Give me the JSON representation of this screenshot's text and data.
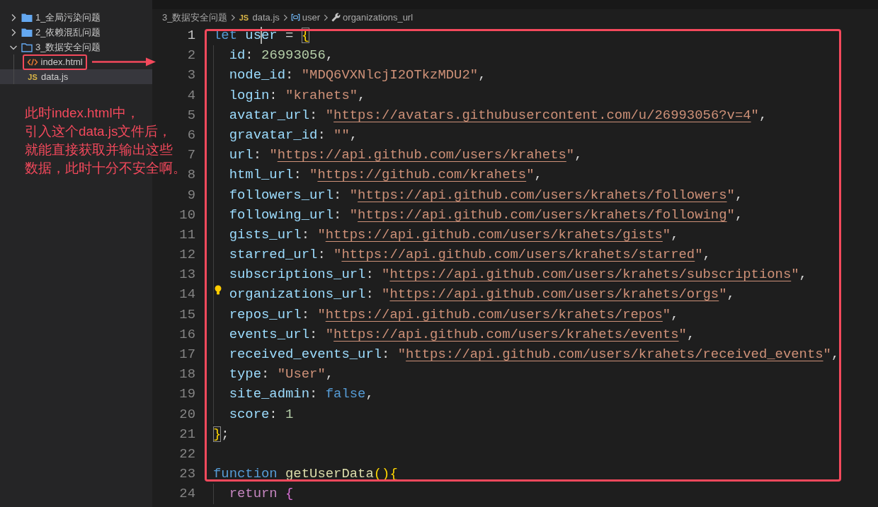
{
  "sidebar": {
    "tree": [
      {
        "kind": "folder",
        "label": "1_全局污染问题",
        "expanded": false,
        "selected": false,
        "highlighted": false
      },
      {
        "kind": "folder",
        "label": "2_依赖混乱问题",
        "expanded": false,
        "selected": false,
        "highlighted": false
      },
      {
        "kind": "folder",
        "label": "3_数据安全问题",
        "expanded": true,
        "selected": false,
        "highlighted": false,
        "children": [
          {
            "kind": "html",
            "label": "index.html",
            "selected": false,
            "highlighted": true
          },
          {
            "kind": "js",
            "icon": "JS",
            "label": "data.js",
            "selected": true,
            "highlighted": false
          }
        ]
      }
    ]
  },
  "editor": {
    "breadcrumb": [
      {
        "kind": "folder",
        "label": "3_数据安全问题"
      },
      {
        "kind": "file",
        "icon": "JS",
        "label": "data.js"
      },
      {
        "kind": "variable",
        "label": "user"
      },
      {
        "kind": "property",
        "label": "organizations_url"
      }
    ],
    "code": {
      "highlighted": true,
      "lines": [
        {
          "number": "1",
          "active": true,
          "lightbulb": false,
          "tokens": [
            {
              "kind": "keyword",
              "text": "let"
            },
            {
              "kind": "variable",
              "text": "us"
            },
            {
              "kind": "cursor"
            },
            {
              "kind": "variable",
              "text": "er"
            },
            {
              "kind": "punct",
              "text": " = "
            },
            {
              "kind": "brace_match",
              "text": "{"
            }
          ],
          "children": [
            {
              "number": "2",
              "active": false,
              "lightbulb": false,
              "tokens": [
                {
                  "kind": "property",
                  "text": "id"
                },
                {
                  "kind": "punct",
                  "text": ": "
                },
                {
                  "kind": "number",
                  "text": "26993056"
                },
                {
                  "kind": "punct",
                  "text": ","
                }
              ]
            },
            {
              "number": "3",
              "active": false,
              "lightbulb": false,
              "tokens": [
                {
                  "kind": "property",
                  "text": "node_id"
                },
                {
                  "kind": "punct",
                  "text": ": "
                },
                {
                  "kind": "string",
                  "text": "\"MDQ6VXNlcjI2OTkzMDU2\""
                },
                {
                  "kind": "punct",
                  "text": ","
                }
              ]
            },
            {
              "number": "4",
              "active": false,
              "lightbulb": false,
              "tokens": [
                {
                  "kind": "property",
                  "text": "login"
                },
                {
                  "kind": "punct",
                  "text": ": "
                },
                {
                  "kind": "string",
                  "text": "\"krahets\""
                },
                {
                  "kind": "punct",
                  "text": ","
                }
              ]
            },
            {
              "number": "5",
              "active": false,
              "lightbulb": false,
              "tokens": [
                {
                  "kind": "property",
                  "text": "avatar_url"
                },
                {
                  "kind": "punct",
                  "text": ": "
                },
                {
                  "kind": "string",
                  "text": "\""
                },
                {
                  "kind": "link",
                  "text": "https://avatars.githubusercontent.com/u/26993056?v=4"
                },
                {
                  "kind": "string",
                  "text": "\""
                },
                {
                  "kind": "punct",
                  "text": ","
                }
              ]
            },
            {
              "number": "6",
              "active": false,
              "lightbulb": false,
              "tokens": [
                {
                  "kind": "property",
                  "text": "gravatar_id"
                },
                {
                  "kind": "punct",
                  "text": ": "
                },
                {
                  "kind": "string",
                  "text": "\"\""
                },
                {
                  "kind": "punct",
                  "text": ","
                }
              ]
            },
            {
              "number": "7",
              "active": false,
              "lightbulb": false,
              "tokens": [
                {
                  "kind": "property",
                  "text": "url"
                },
                {
                  "kind": "punct",
                  "text": ": "
                },
                {
                  "kind": "string",
                  "text": "\""
                },
                {
                  "kind": "link",
                  "text": "https://api.github.com/users/krahets"
                },
                {
                  "kind": "string",
                  "text": "\""
                },
                {
                  "kind": "punct",
                  "text": ","
                }
              ]
            },
            {
              "number": "8",
              "active": false,
              "lightbulb": false,
              "tokens": [
                {
                  "kind": "property",
                  "text": "html_url"
                },
                {
                  "kind": "punct",
                  "text": ": "
                },
                {
                  "kind": "string",
                  "text": "\""
                },
                {
                  "kind": "link",
                  "text": "https://github.com/krahets"
                },
                {
                  "kind": "string",
                  "text": "\""
                },
                {
                  "kind": "punct",
                  "text": ","
                }
              ]
            },
            {
              "number": "9",
              "active": false,
              "lightbulb": false,
              "tokens": [
                {
                  "kind": "property",
                  "text": "followers_url"
                },
                {
                  "kind": "punct",
                  "text": ": "
                },
                {
                  "kind": "string",
                  "text": "\""
                },
                {
                  "kind": "link",
                  "text": "https://api.github.com/users/krahets/followers"
                },
                {
                  "kind": "string",
                  "text": "\""
                },
                {
                  "kind": "punct",
                  "text": ","
                }
              ]
            },
            {
              "number": "10",
              "active": false,
              "lightbulb": false,
              "tokens": [
                {
                  "kind": "property",
                  "text": "following_url"
                },
                {
                  "kind": "punct",
                  "text": ": "
                },
                {
                  "kind": "string",
                  "text": "\""
                },
                {
                  "kind": "link",
                  "text": "https://api.github.com/users/krahets/following"
                },
                {
                  "kind": "string",
                  "text": "\""
                },
                {
                  "kind": "punct",
                  "text": ","
                }
              ]
            },
            {
              "number": "11",
              "active": false,
              "lightbulb": false,
              "tokens": [
                {
                  "kind": "property",
                  "text": "gists_url"
                },
                {
                  "kind": "punct",
                  "text": ": "
                },
                {
                  "kind": "string",
                  "text": "\""
                },
                {
                  "kind": "link",
                  "text": "https://api.github.com/users/krahets/gists"
                },
                {
                  "kind": "string",
                  "text": "\""
                },
                {
                  "kind": "punct",
                  "text": ","
                }
              ]
            },
            {
              "number": "12",
              "active": false,
              "lightbulb": false,
              "tokens": [
                {
                  "kind": "property",
                  "text": "starred_url"
                },
                {
                  "kind": "punct",
                  "text": ": "
                },
                {
                  "kind": "string",
                  "text": "\""
                },
                {
                  "kind": "link",
                  "text": "https://api.github.com/users/krahets/starred"
                },
                {
                  "kind": "string",
                  "text": "\""
                },
                {
                  "kind": "punct",
                  "text": ","
                }
              ]
            },
            {
              "number": "13",
              "active": false,
              "lightbulb": false,
              "tokens": [
                {
                  "kind": "property",
                  "text": "subscriptions_url"
                },
                {
                  "kind": "punct",
                  "text": ": "
                },
                {
                  "kind": "string",
                  "text": "\""
                },
                {
                  "kind": "link",
                  "text": "https://api.github.com/users/krahets/subscriptions"
                },
                {
                  "kind": "string",
                  "text": "\""
                },
                {
                  "kind": "punct",
                  "text": ","
                }
              ]
            },
            {
              "number": "14",
              "active": false,
              "lightbulb": true,
              "tokens": [
                {
                  "kind": "property",
                  "text": "organizations_url"
                },
                {
                  "kind": "punct",
                  "text": ": "
                },
                {
                  "kind": "string",
                  "text": "\""
                },
                {
                  "kind": "link",
                  "text": "https://api.github.com/users/krahets/orgs"
                },
                {
                  "kind": "string",
                  "text": "\""
                },
                {
                  "kind": "punct",
                  "text": ","
                }
              ]
            },
            {
              "number": "15",
              "active": false,
              "lightbulb": false,
              "tokens": [
                {
                  "kind": "property",
                  "text": "repos_url"
                },
                {
                  "kind": "punct",
                  "text": ": "
                },
                {
                  "kind": "string",
                  "text": "\""
                },
                {
                  "kind": "link",
                  "text": "https://api.github.com/users/krahets/repos"
                },
                {
                  "kind": "string",
                  "text": "\""
                },
                {
                  "kind": "punct",
                  "text": ","
                }
              ]
            },
            {
              "number": "16",
              "active": false,
              "lightbulb": false,
              "tokens": [
                {
                  "kind": "property",
                  "text": "events_url"
                },
                {
                  "kind": "punct",
                  "text": ": "
                },
                {
                  "kind": "string",
                  "text": "\""
                },
                {
                  "kind": "link",
                  "text": "https://api.github.com/users/krahets/events"
                },
                {
                  "kind": "string",
                  "text": "\""
                },
                {
                  "kind": "punct",
                  "text": ","
                }
              ]
            },
            {
              "number": "17",
              "active": false,
              "lightbulb": false,
              "tokens": [
                {
                  "kind": "property",
                  "text": "received_events_url"
                },
                {
                  "kind": "punct",
                  "text": ": "
                },
                {
                  "kind": "string",
                  "text": "\""
                },
                {
                  "kind": "link",
                  "text": "https://api.github.com/users/krahets/received_events"
                },
                {
                  "kind": "string",
                  "text": "\""
                },
                {
                  "kind": "punct",
                  "text": ","
                }
              ]
            },
            {
              "number": "18",
              "active": false,
              "lightbulb": false,
              "tokens": [
                {
                  "kind": "property",
                  "text": "type"
                },
                {
                  "kind": "punct",
                  "text": ": "
                },
                {
                  "kind": "string",
                  "text": "\"User\""
                },
                {
                  "kind": "punct",
                  "text": ","
                }
              ]
            },
            {
              "number": "19",
              "active": false,
              "lightbulb": false,
              "tokens": [
                {
                  "kind": "property",
                  "text": "site_admin"
                },
                {
                  "kind": "punct",
                  "text": ": "
                },
                {
                  "kind": "literal",
                  "text": "false"
                },
                {
                  "kind": "punct",
                  "text": ","
                }
              ]
            },
            {
              "number": "20",
              "active": false,
              "lightbulb": false,
              "tokens": [
                {
                  "kind": "property",
                  "text": "score"
                },
                {
                  "kind": "punct",
                  "text": ": "
                },
                {
                  "kind": "number",
                  "text": "1"
                }
              ]
            }
          ]
        },
        {
          "number": "21",
          "active": false,
          "lightbulb": false,
          "tokens": [
            {
              "kind": "brace_match",
              "text": "}"
            },
            {
              "kind": "punct",
              "text": ";"
            }
          ]
        },
        {
          "number": "22",
          "active": false,
          "lightbulb": false
        },
        {
          "number": "23",
          "active": false,
          "lightbulb": false,
          "tokens": [
            {
              "kind": "keyword",
              "text": "function"
            },
            {
              "kind": "function",
              "text": "getUserData"
            },
            {
              "kind": "brace",
              "text": "(){"
            }
          ],
          "children": [
            {
              "number": "24",
              "active": false,
              "lightbulb": false,
              "tokens": [
                {
                  "kind": "control",
                  "text": "return"
                },
                {
                  "kind": "brace2",
                  "text": "{"
                }
              ]
            }
          ]
        }
      ]
    }
  },
  "annotation": {
    "note": [
      "此时index.html中，",
      "引入这个data.js文件后，",
      "就能直接获取并输出这些",
      "数据，此时十分不安全啊。"
    ]
  }
}
